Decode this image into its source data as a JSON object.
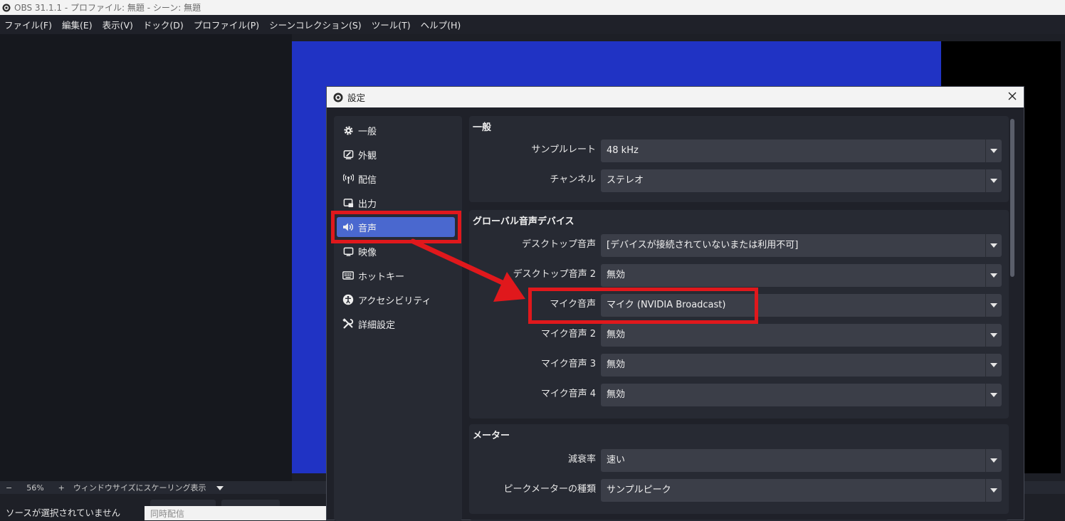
{
  "window": {
    "title": "OBS 31.1.1 - プロファイル: 無題 - シーン: 無題"
  },
  "menu": [
    "ファイル(F)",
    "編集(E)",
    "表示(V)",
    "ドック(D)",
    "プロファイル(P)",
    "シーンコレクション(S)",
    "ツール(T)",
    "ヘルプ(H)"
  ],
  "preview_bar": {
    "minus": "−",
    "zoom": "56%",
    "plus": "+",
    "scaling": "ウィンドウサイズにスケーリング表示"
  },
  "sources": {
    "empty_text": "ソースが選択されていません"
  },
  "simulcast": {
    "placeholder": "同時配信"
  },
  "colors": {
    "accent": "#4a68cf",
    "preview_blue": "#2033c4",
    "annotation_red": "#e0181c"
  },
  "dialog": {
    "title": "設定",
    "nav": [
      {
        "label": "一般",
        "icon": "gear-icon"
      },
      {
        "label": "外観",
        "icon": "appearance-icon"
      },
      {
        "label": "配信",
        "icon": "broadcast-icon"
      },
      {
        "label": "出力",
        "icon": "output-icon"
      },
      {
        "label": "音声",
        "icon": "speaker-icon",
        "active": true
      },
      {
        "label": "映像",
        "icon": "monitor-icon"
      },
      {
        "label": "ホットキー",
        "icon": "keyboard-icon"
      },
      {
        "label": "アクセシビリティ",
        "icon": "accessibility-icon"
      },
      {
        "label": "詳細設定",
        "icon": "tools-icon"
      }
    ],
    "general": {
      "title": "一般",
      "sample_rate": {
        "label": "サンプルレート",
        "value": "48 kHz"
      },
      "channels": {
        "label": "チャンネル",
        "value": "ステレオ"
      }
    },
    "global_devices": {
      "title": "グローバル音声デバイス",
      "rows": [
        {
          "label": "デスクトップ音声",
          "value": "[デバイスが接続されていないまたは利用不可]"
        },
        {
          "label": "デスクトップ音声 2",
          "value": "無効"
        },
        {
          "label": "マイク音声",
          "value": "マイク (NVIDIA Broadcast)"
        },
        {
          "label": "マイク音声 2",
          "value": "無効"
        },
        {
          "label": "マイク音声 3",
          "value": "無効"
        },
        {
          "label": "マイク音声 4",
          "value": "無効"
        }
      ]
    },
    "meters": {
      "title": "メーター",
      "decay": {
        "label": "減衰率",
        "value": "速い"
      },
      "peak_type": {
        "label": "ピークメーターの種類",
        "value": "サンプルピーク"
      }
    }
  }
}
